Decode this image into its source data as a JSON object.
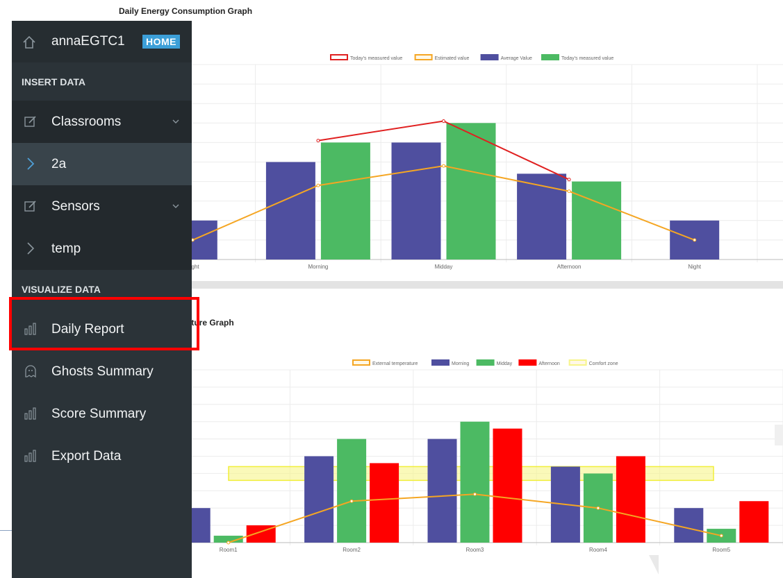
{
  "page": {
    "energy_title": "Daily Energy Consumption Graph",
    "temp_title_visible": "rature Graph"
  },
  "sidebar": {
    "user": "annaEGTC1",
    "home_badge": "HOME",
    "section_insert": "INSERT DATA",
    "section_visualize": "VISUALIZE DATA",
    "items": [
      {
        "label": "Classrooms",
        "icon": "edit-icon"
      },
      {
        "label": "2a",
        "icon": "chevron-right-icon"
      },
      {
        "label": "Sensors",
        "icon": "edit-icon"
      },
      {
        "label": "temp",
        "icon": "chevron-right-icon"
      },
      {
        "label": "Daily Report",
        "icon": "bar-chart-icon"
      },
      {
        "label": "Ghosts Summary",
        "icon": "ghost-icon"
      },
      {
        "label": "Score Summary",
        "icon": "bar-chart-icon"
      },
      {
        "label": "Export Data",
        "icon": "bar-chart-icon"
      }
    ],
    "colors": {
      "accent": "#3c9fd8",
      "highlight": "#ff0000"
    }
  },
  "chart_data": [
    {
      "type": "bar",
      "title": "Daily Energy Consumption Graph",
      "categories": [
        "Night",
        "Morning",
        "Midday",
        "Afternoon",
        "Night"
      ],
      "ylim": [
        0,
        10
      ],
      "grid": true,
      "legend_position": "top",
      "series": [
        {
          "name": "Today's measured value",
          "kind": "line",
          "color": "#e02020",
          "values": [
            null,
            6.1,
            7.1,
            4.1,
            null
          ]
        },
        {
          "name": "Estimated value",
          "kind": "line",
          "color": "#f5a623",
          "values": [
            1.0,
            3.8,
            4.8,
            3.5,
            1.0
          ]
        },
        {
          "name": "Average Value",
          "kind": "bar",
          "color": "#4f4f9f",
          "values": [
            2.0,
            5.0,
            6.0,
            4.4,
            2.0
          ]
        },
        {
          "name": "Today's measured value",
          "kind": "bar",
          "color": "#4cba63",
          "values": [
            null,
            6.0,
            7.0,
            4.0,
            null
          ]
        }
      ]
    },
    {
      "type": "bar",
      "title": "rature Graph",
      "categories": [
        "Room1",
        "Room2",
        "Room3",
        "Room4",
        "Room5"
      ],
      "ylim": [
        0,
        10
      ],
      "grid": true,
      "legend_position": "top",
      "comfort_zone": [
        3.6,
        4.4
      ],
      "series": [
        {
          "name": "External temperature",
          "kind": "line",
          "color": "#f5a623",
          "values": [
            0.0,
            2.4,
            2.8,
            2.0,
            0.4
          ]
        },
        {
          "name": "Morning",
          "kind": "bar",
          "color": "#4f4f9f",
          "values": [
            2.0,
            5.0,
            6.0,
            4.4,
            2.0
          ]
        },
        {
          "name": "Midday",
          "kind": "bar",
          "color": "#4cba63",
          "values": [
            0.4,
            6.0,
            7.0,
            4.0,
            0.8
          ]
        },
        {
          "name": "Afternoon",
          "kind": "bar",
          "color": "#ff0000",
          "values": [
            1.0,
            4.6,
            6.6,
            5.0,
            2.4
          ]
        },
        {
          "name": "Comfort zone",
          "kind": "band",
          "color": "#f7f58a",
          "values": []
        }
      ]
    }
  ]
}
